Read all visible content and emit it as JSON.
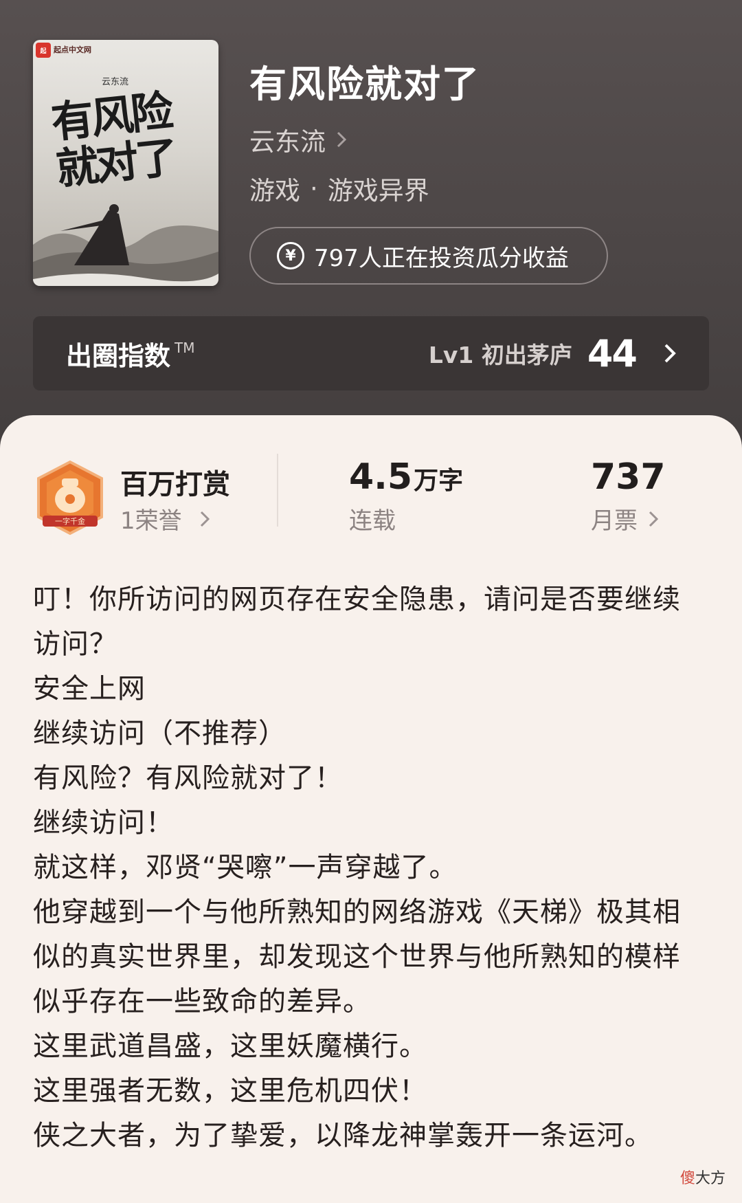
{
  "book": {
    "title": "有风险就对了",
    "author": "云东流",
    "genre_main": "游戏",
    "genre_separator": "·",
    "genre_sub": "游戏异界",
    "invest_text": "797人正在投资瓜分收益",
    "invest_icon": "yen-icon"
  },
  "cover": {
    "publisher": "起点中文网",
    "author": "云东流",
    "title": "有风险就对了"
  },
  "index_bar": {
    "label": "出圈指数",
    "trademark": "TM",
    "level": "Lv1 初出茅庐",
    "score": "44"
  },
  "stats": {
    "award_name": "百万打赏",
    "award_sub": "1荣誉",
    "badge_text": "一字千金",
    "words_value": "4.5",
    "words_unit": "万字",
    "words_sub": "连载",
    "tickets_value": "737",
    "tickets_sub": "月票"
  },
  "synopsis": [
    "叮！你所访问的网页存在安全隐患，请问是否要继续访问？",
    "安全上网",
    "继续访问（不推荐）",
    "有风险？有风险就对了！",
    "继续访问！",
    "就这样，邓贤“哭嚓”一声穿越了。",
    "他穿越到一个与他所熟知的网络游戏《天梯》极其相似的真实世界里，却发现这个世界与他所熟知的模样似乎存在一些致命的差异。",
    "这里武道昌盛，这里妖魔横行。",
    "这里强者无数，这里危机四伏！",
    "侠之大者，为了挚爱，以降龙神掌轰开一条运河。"
  ],
  "watermark": {
    "first_char": "傻",
    "rest": "大方"
  },
  "colors": {
    "header_bg": "#4c4646",
    "sheet_bg": "#f8f1ec",
    "badge_orange": "#e7762f"
  }
}
